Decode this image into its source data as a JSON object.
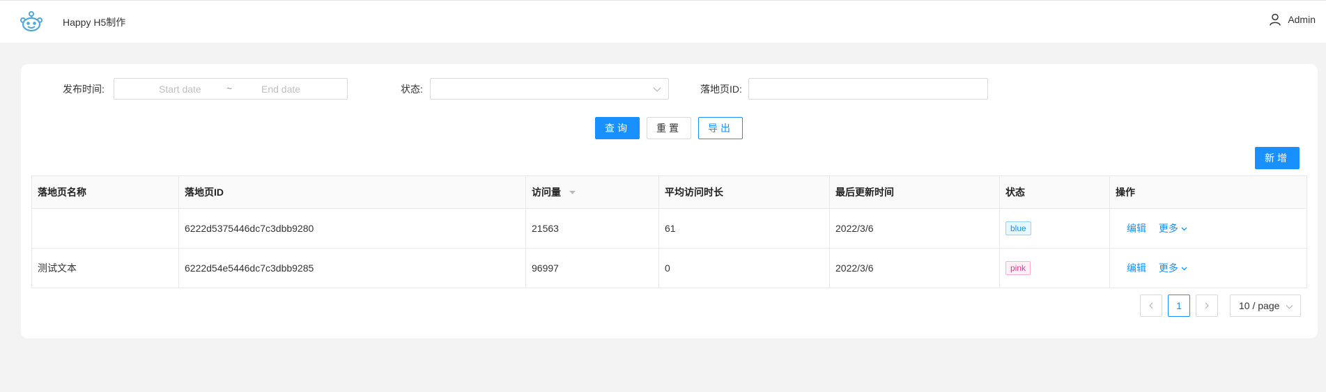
{
  "header": {
    "app_title": "Happy H5制作",
    "user_name": "Admin"
  },
  "filters": {
    "publish_time_label": "发布时间:",
    "start_placeholder": "Start date",
    "range_separator": "~",
    "end_placeholder": "End date",
    "status_label": "状态:",
    "status_value": "",
    "page_id_label": "落地页ID:",
    "page_id_value": ""
  },
  "buttons": {
    "query": "查询",
    "reset": "重置",
    "export": "导出",
    "add": "新增"
  },
  "table": {
    "columns": [
      "落地页名称",
      "落地页ID",
      "访问量",
      "平均访问时长",
      "最后更新时间",
      "状态",
      "操作"
    ],
    "rows": [
      {
        "name": "",
        "id": "6222d5375446dc7c3dbb9280",
        "visits": "21563",
        "avg_duration": "61",
        "updated": "2022/3/6",
        "status": "blue",
        "edit": "编辑",
        "more": "更多"
      },
      {
        "name": "测试文本",
        "id": "6222d54e5446dc7c3dbb9285",
        "visits": "96997",
        "avg_duration": "0",
        "updated": "2022/3/6",
        "status": "pink",
        "edit": "编辑",
        "more": "更多"
      }
    ]
  },
  "pagination": {
    "current_page": "1",
    "page_size": "10 / page"
  },
  "colors": {
    "primary": "#1890ff",
    "tag_blue": "#1890ff",
    "tag_pink": "#eb2f96",
    "logo": "#4fa8d8"
  },
  "icons": [
    "logo-icon",
    "user-icon",
    "chevron-down-icon",
    "sort-caret-icon",
    "chevron-left-icon",
    "chevron-right-icon"
  ]
}
